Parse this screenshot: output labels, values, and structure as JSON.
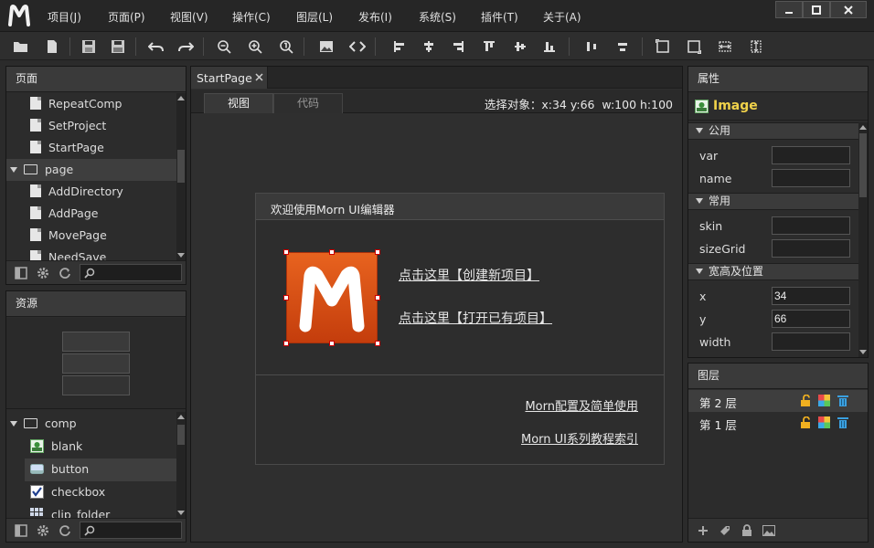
{
  "menubar": {
    "items": [
      "项目(J)",
      "页面(P)",
      "视图(V)",
      "操作(C)",
      "图层(L)",
      "发布(I)",
      "系统(S)",
      "插件(T)",
      "关于(A)"
    ]
  },
  "pages_panel": {
    "title": "页面",
    "items": [
      {
        "label": "RepeatComp",
        "kind": "file"
      },
      {
        "label": "SetProject",
        "kind": "file"
      },
      {
        "label": "StartPage",
        "kind": "file"
      },
      {
        "label": "page",
        "kind": "folder"
      },
      {
        "label": "AddDirectory",
        "kind": "file"
      },
      {
        "label": "AddPage",
        "kind": "file"
      },
      {
        "label": "MovePage",
        "kind": "file"
      },
      {
        "label": "NeedSave",
        "kind": "file"
      }
    ]
  },
  "resources_panel": {
    "title": "资源",
    "tree": [
      {
        "label": "comp",
        "kind": "folder"
      },
      {
        "label": "blank",
        "icon": "image-icon"
      },
      {
        "label": "button",
        "icon": "button-icon"
      },
      {
        "label": "checkbox",
        "icon": "checkbox-icon"
      },
      {
        "label": "clip_folder",
        "icon": "grid-icon"
      }
    ]
  },
  "editor": {
    "tab_label": "StartPage",
    "view_tabs": [
      "视图",
      "代码"
    ],
    "selection_info": "选择对象：x:34 y:66  w:100 h:100",
    "welcome": {
      "title": "欢迎使用Morn UI编辑器",
      "create_link": "点击这里【创建新项目】",
      "open_link": "点击这里【打开已有项目】",
      "config_link": "Morn配置及简单使用",
      "tutorial_link": "Morn UI系列教程索引"
    }
  },
  "properties_panel": {
    "title": "属性",
    "component": "Image",
    "groups": [
      {
        "title": "公用",
        "fields": [
          {
            "label": "var",
            "value": ""
          },
          {
            "label": "name",
            "value": ""
          }
        ]
      },
      {
        "title": "常用",
        "fields": [
          {
            "label": "skin",
            "value": ""
          },
          {
            "label": "sizeGrid",
            "value": ""
          }
        ]
      },
      {
        "title": "宽高及位置",
        "fields": [
          {
            "label": "x",
            "value": "34"
          },
          {
            "label": "y",
            "value": "66"
          },
          {
            "label": "width",
            "value": ""
          }
        ]
      }
    ]
  },
  "layers_panel": {
    "title": "图层",
    "layers": [
      "第 2 层",
      "第 1 层"
    ]
  },
  "colors": {
    "accent_orange": "#e0561b",
    "logo_bg": "#d24a12",
    "selected_row": "#3e3e3e"
  }
}
